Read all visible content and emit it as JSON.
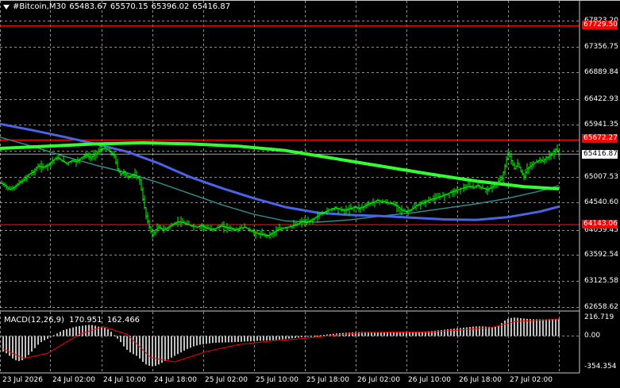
{
  "header": {
    "symbol": "#Bitcoin,M30",
    "open": "65483.67",
    "high": "65570.15",
    "low": "65396.02",
    "close": "65416.87"
  },
  "macd_header": {
    "title": "MACD(12,26,9)",
    "macd_value": "170.951",
    "signal_value": "162.466"
  },
  "price_axis": {
    "ticks": [
      "67823.20",
      "67356.75",
      "66889.84",
      "66422.93",
      "65941.35",
      "65007.53",
      "64540.60",
      "64059.45",
      "63592.54",
      "63125.58",
      "62658.62"
    ],
    "current_price": "65416.87"
  },
  "horizontal_levels": [
    {
      "label": "67729.50",
      "price": 67729.5
    },
    {
      "label": "65672.27",
      "price": 65672.27
    },
    {
      "label": "64143.06",
      "price": 64143.06
    }
  ],
  "time_axis": {
    "ticks": [
      "23 Jul 2026",
      "24 Jul 02:00",
      "24 Jul 10:00",
      "24 Jul 18:00",
      "25 Jul 02:00",
      "25 Jul 10:00",
      "25 Jul 18:00",
      "26 Jul 02:00",
      "26 Jul 10:00",
      "26 Jul 18:00",
      "27 Jul 02:00"
    ]
  },
  "macd_axis": {
    "ticks": [
      "216.719",
      "0.00",
      "-354.354"
    ]
  },
  "colors": {
    "background": "#000000",
    "grid": "#c8c8c8",
    "candles": "#00ff00",
    "level_line": "#ff0000",
    "ma_slow_green": "#33ff33",
    "ma_blue": "#4a64e8",
    "ma_teal": "#2e8b8b",
    "macd_histogram": "#c0c0c0",
    "macd_signal": "#ff0000"
  },
  "chart_data": {
    "type": "candlestick",
    "price_range": [
      62658.62,
      68000
    ],
    "macd_range": [
      -354.354,
      216.719
    ],
    "price_path": [
      [
        0,
        64900
      ],
      [
        6,
        64850
      ],
      [
        12,
        64780
      ],
      [
        18,
        64820
      ],
      [
        24,
        64900
      ],
      [
        30,
        64950
      ],
      [
        36,
        65050
      ],
      [
        42,
        65100
      ],
      [
        48,
        65200
      ],
      [
        54,
        65180
      ],
      [
        60,
        65220
      ],
      [
        66,
        65300
      ],
      [
        72,
        65350
      ],
      [
        78,
        65300
      ],
      [
        84,
        65250
      ],
      [
        90,
        65300
      ],
      [
        96,
        65280
      ],
      [
        102,
        65350
      ],
      [
        108,
        65400
      ],
      [
        114,
        65350
      ],
      [
        120,
        65420
      ],
      [
        126,
        65500
      ],
      [
        132,
        65520
      ],
      [
        136,
        65480
      ],
      [
        140,
        65430
      ],
      [
        144,
        65380
      ],
      [
        148,
        65150
      ],
      [
        152,
        65050
      ],
      [
        156,
        65100
      ],
      [
        160,
        65000
      ],
      [
        164,
        65020
      ],
      [
        168,
        65050
      ],
      [
        172,
        65000
      ],
      [
        176,
        64950
      ],
      [
        180,
        64600
      ],
      [
        184,
        64300
      ],
      [
        188,
        64100
      ],
      [
        192,
        63950
      ],
      [
        196,
        64050
      ],
      [
        200,
        64100
      ],
      [
        206,
        64050
      ],
      [
        212,
        64100
      ],
      [
        218,
        64150
      ],
      [
        224,
        64200
      ],
      [
        230,
        64180
      ],
      [
        236,
        64150
      ],
      [
        242,
        64120
      ],
      [
        248,
        64100
      ],
      [
        254,
        64130
      ],
      [
        260,
        64080
      ],
      [
        266,
        64060
      ],
      [
        272,
        64080
      ],
      [
        278,
        64120
      ],
      [
        284,
        64100
      ],
      [
        290,
        64080
      ],
      [
        296,
        64050
      ],
      [
        302,
        64080
      ],
      [
        308,
        64100
      ],
      [
        314,
        64050
      ],
      [
        320,
        64000
      ],
      [
        326,
        63980
      ],
      [
        332,
        63960
      ],
      [
        338,
        63950
      ],
      [
        344,
        64000
      ],
      [
        350,
        64050
      ],
      [
        356,
        64080
      ],
      [
        362,
        64100
      ],
      [
        368,
        64120
      ],
      [
        374,
        64150
      ],
      [
        380,
        64200
      ],
      [
        386,
        64180
      ],
      [
        392,
        64220
      ],
      [
        398,
        64280
      ],
      [
        404,
        64340
      ],
      [
        410,
        64380
      ],
      [
        416,
        64420
      ],
      [
        422,
        64450
      ],
      [
        428,
        64420
      ],
      [
        434,
        64400
      ],
      [
        440,
        64430
      ],
      [
        446,
        64460
      ],
      [
        452,
        64440
      ],
      [
        458,
        64470
      ],
      [
        464,
        64520
      ],
      [
        470,
        64550
      ],
      [
        476,
        64580
      ],
      [
        482,
        64560
      ],
      [
        488,
        64540
      ],
      [
        494,
        64520
      ],
      [
        500,
        64480
      ],
      [
        506,
        64400
      ],
      [
        512,
        64380
      ],
      [
        518,
        64420
      ],
      [
        524,
        64480
      ],
      [
        530,
        64520
      ],
      [
        536,
        64560
      ],
      [
        542,
        64600
      ],
      [
        548,
        64620
      ],
      [
        554,
        64650
      ],
      [
        560,
        64680
      ],
      [
        566,
        64720
      ],
      [
        572,
        64750
      ],
      [
        578,
        64780
      ],
      [
        584,
        64810
      ],
      [
        590,
        64830
      ],
      [
        596,
        64820
      ],
      [
        602,
        64850
      ],
      [
        608,
        64800
      ],
      [
        614,
        64780
      ],
      [
        620,
        64820
      ],
      [
        626,
        64900
      ],
      [
        632,
        64980
      ],
      [
        636,
        65200
      ],
      [
        640,
        65450
      ],
      [
        644,
        65300
      ],
      [
        648,
        65150
      ],
      [
        652,
        65250
      ],
      [
        656,
        65100
      ],
      [
        660,
        65020
      ],
      [
        664,
        65150
      ],
      [
        668,
        65200
      ],
      [
        672,
        65250
      ],
      [
        676,
        65280
      ],
      [
        680,
        65320
      ],
      [
        684,
        65280
      ],
      [
        688,
        65350
      ],
      [
        692,
        65380
      ],
      [
        696,
        65420
      ],
      [
        700,
        65500
      ],
      [
        704,
        65416
      ]
    ],
    "ma_green": [
      [
        0,
        65520
      ],
      [
        60,
        65560
      ],
      [
        120,
        65600
      ],
      [
        180,
        65620
      ],
      [
        240,
        65600
      ],
      [
        300,
        65560
      ],
      [
        360,
        65480
      ],
      [
        420,
        65340
      ],
      [
        480,
        65200
      ],
      [
        540,
        65060
      ],
      [
        600,
        64930
      ],
      [
        660,
        64830
      ],
      [
        704,
        64790
      ]
    ],
    "ma_blue": [
      [
        0,
        65960
      ],
      [
        40,
        65850
      ],
      [
        80,
        65730
      ],
      [
        120,
        65600
      ],
      [
        160,
        65460
      ],
      [
        200,
        65250
      ],
      [
        240,
        65000
      ],
      [
        280,
        64800
      ],
      [
        320,
        64620
      ],
      [
        360,
        64460
      ],
      [
        400,
        64360
      ],
      [
        440,
        64320
      ],
      [
        480,
        64300
      ],
      [
        520,
        64270
      ],
      [
        560,
        64240
      ],
      [
        600,
        64230
      ],
      [
        640,
        64280
      ],
      [
        680,
        64380
      ],
      [
        704,
        64470
      ]
    ],
    "ma_teal": [
      [
        0,
        65720
      ],
      [
        40,
        65560
      ],
      [
        80,
        65380
      ],
      [
        120,
        65220
      ],
      [
        160,
        65080
      ],
      [
        200,
        64900
      ],
      [
        240,
        64700
      ],
      [
        280,
        64500
      ],
      [
        320,
        64330
      ],
      [
        360,
        64210
      ],
      [
        400,
        64190
      ],
      [
        440,
        64230
      ],
      [
        480,
        64300
      ],
      [
        520,
        64360
      ],
      [
        560,
        64440
      ],
      [
        600,
        64520
      ],
      [
        640,
        64620
      ],
      [
        680,
        64750
      ],
      [
        704,
        64850
      ]
    ],
    "macd_hist": [
      [
        4,
        -180
      ],
      [
        8,
        -200
      ],
      [
        12,
        -230
      ],
      [
        16,
        -260
      ],
      [
        20,
        -280
      ],
      [
        24,
        -290
      ],
      [
        28,
        -280
      ],
      [
        32,
        -250
      ],
      [
        36,
        -220
      ],
      [
        40,
        -180
      ],
      [
        44,
        -140
      ],
      [
        48,
        -100
      ],
      [
        52,
        -70
      ],
      [
        56,
        -50
      ],
      [
        60,
        -30
      ],
      [
        64,
        -10
      ],
      [
        68,
        10
      ],
      [
        72,
        30
      ],
      [
        76,
        50
      ],
      [
        80,
        70
      ],
      [
        84,
        80
      ],
      [
        88,
        90
      ],
      [
        92,
        100
      ],
      [
        96,
        110
      ],
      [
        100,
        115
      ],
      [
        104,
        120
      ],
      [
        108,
        125
      ],
      [
        112,
        130
      ],
      [
        116,
        128
      ],
      [
        120,
        120
      ],
      [
        124,
        110
      ],
      [
        128,
        100
      ],
      [
        132,
        95
      ],
      [
        136,
        80
      ],
      [
        140,
        50
      ],
      [
        144,
        10
      ],
      [
        148,
        -30
      ],
      [
        152,
        -70
      ],
      [
        156,
        -120
      ],
      [
        160,
        -160
      ],
      [
        164,
        -190
      ],
      [
        168,
        -210
      ],
      [
        172,
        -230
      ],
      [
        176,
        -260
      ],
      [
        180,
        -300
      ],
      [
        184,
        -330
      ],
      [
        188,
        -345
      ],
      [
        192,
        -350
      ],
      [
        196,
        -345
      ],
      [
        200,
        -330
      ],
      [
        204,
        -310
      ],
      [
        208,
        -290
      ],
      [
        212,
        -270
      ],
      [
        216,
        -250
      ],
      [
        220,
        -230
      ],
      [
        224,
        -210
      ],
      [
        228,
        -190
      ],
      [
        232,
        -170
      ],
      [
        236,
        -150
      ],
      [
        240,
        -135
      ],
      [
        244,
        -120
      ],
      [
        248,
        -110
      ],
      [
        252,
        -100
      ],
      [
        256,
        -95
      ],
      [
        260,
        -90
      ],
      [
        264,
        -85
      ],
      [
        268,
        -80
      ],
      [
        272,
        -78
      ],
      [
        276,
        -76
      ],
      [
        280,
        -75
      ],
      [
        284,
        -74
      ],
      [
        288,
        -73
      ],
      [
        292,
        -72
      ],
      [
        296,
        -70
      ],
      [
        300,
        -68
      ],
      [
        304,
        -66
      ],
      [
        308,
        -64
      ],
      [
        312,
        -62
      ],
      [
        316,
        -60
      ],
      [
        320,
        -58
      ],
      [
        324,
        -56
      ],
      [
        328,
        -55
      ],
      [
        332,
        -54
      ],
      [
        336,
        -52
      ],
      [
        340,
        -50
      ],
      [
        344,
        -48
      ],
      [
        348,
        -45
      ],
      [
        352,
        -42
      ],
      [
        356,
        -38
      ],
      [
        360,
        -34
      ],
      [
        364,
        -30
      ],
      [
        368,
        -26
      ],
      [
        372,
        -22
      ],
      [
        376,
        -18
      ],
      [
        380,
        -14
      ],
      [
        384,
        -10
      ],
      [
        388,
        -6
      ],
      [
        392,
        -2
      ],
      [
        396,
        2
      ],
      [
        400,
        6
      ],
      [
        404,
        10
      ],
      [
        408,
        14
      ],
      [
        412,
        18
      ],
      [
        416,
        22
      ],
      [
        420,
        26
      ],
      [
        424,
        30
      ],
      [
        428,
        33
      ],
      [
        432,
        36
      ],
      [
        436,
        38
      ],
      [
        440,
        40
      ],
      [
        444,
        42
      ],
      [
        448,
        44
      ],
      [
        452,
        46
      ],
      [
        456,
        47
      ],
      [
        460,
        48
      ],
      [
        464,
        48
      ],
      [
        468,
        48
      ],
      [
        472,
        47
      ],
      [
        476,
        46
      ],
      [
        480,
        45
      ],
      [
        484,
        44
      ],
      [
        488,
        43
      ],
      [
        492,
        42
      ],
      [
        496,
        41
      ],
      [
        500,
        40
      ],
      [
        504,
        40
      ],
      [
        508,
        40
      ],
      [
        512,
        41
      ],
      [
        516,
        42
      ],
      [
        520,
        44
      ],
      [
        524,
        46
      ],
      [
        528,
        48
      ],
      [
        532,
        50
      ],
      [
        536,
        52
      ],
      [
        540,
        55
      ],
      [
        544,
        58
      ],
      [
        548,
        62
      ],
      [
        552,
        66
      ],
      [
        556,
        70
      ],
      [
        560,
        74
      ],
      [
        564,
        78
      ],
      [
        568,
        82
      ],
      [
        572,
        86
      ],
      [
        576,
        90
      ],
      [
        580,
        94
      ],
      [
        584,
        98
      ],
      [
        588,
        102
      ],
      [
        592,
        106
      ],
      [
        596,
        110
      ],
      [
        600,
        112
      ],
      [
        604,
        113
      ],
      [
        608,
        112
      ],
      [
        612,
        110
      ],
      [
        616,
        108
      ],
      [
        620,
        106
      ],
      [
        624,
        108
      ],
      [
        628,
        120
      ],
      [
        632,
        150
      ],
      [
        636,
        180
      ],
      [
        640,
        200
      ],
      [
        644,
        210
      ],
      [
        648,
        215
      ],
      [
        652,
        212
      ],
      [
        656,
        208
      ],
      [
        660,
        204
      ],
      [
        664,
        200
      ],
      [
        668,
        198
      ],
      [
        672,
        196
      ],
      [
        676,
        195
      ],
      [
        680,
        194
      ],
      [
        684,
        193
      ],
      [
        688,
        194
      ],
      [
        692,
        196
      ],
      [
        696,
        198
      ],
      [
        700,
        200
      ],
      [
        704,
        202
      ]
    ],
    "macd_signal": [
      [
        4,
        -150
      ],
      [
        30,
        -260
      ],
      [
        60,
        -200
      ],
      [
        100,
        20
      ],
      [
        130,
        110
      ],
      [
        160,
        20
      ],
      [
        190,
        -250
      ],
      [
        220,
        -300
      ],
      [
        260,
        -180
      ],
      [
        300,
        -100
      ],
      [
        340,
        -60
      ],
      [
        380,
        -30
      ],
      [
        420,
        10
      ],
      [
        460,
        40
      ],
      [
        500,
        45
      ],
      [
        540,
        45
      ],
      [
        580,
        70
      ],
      [
        620,
        100
      ],
      [
        650,
        170
      ],
      [
        704,
        195
      ]
    ]
  }
}
